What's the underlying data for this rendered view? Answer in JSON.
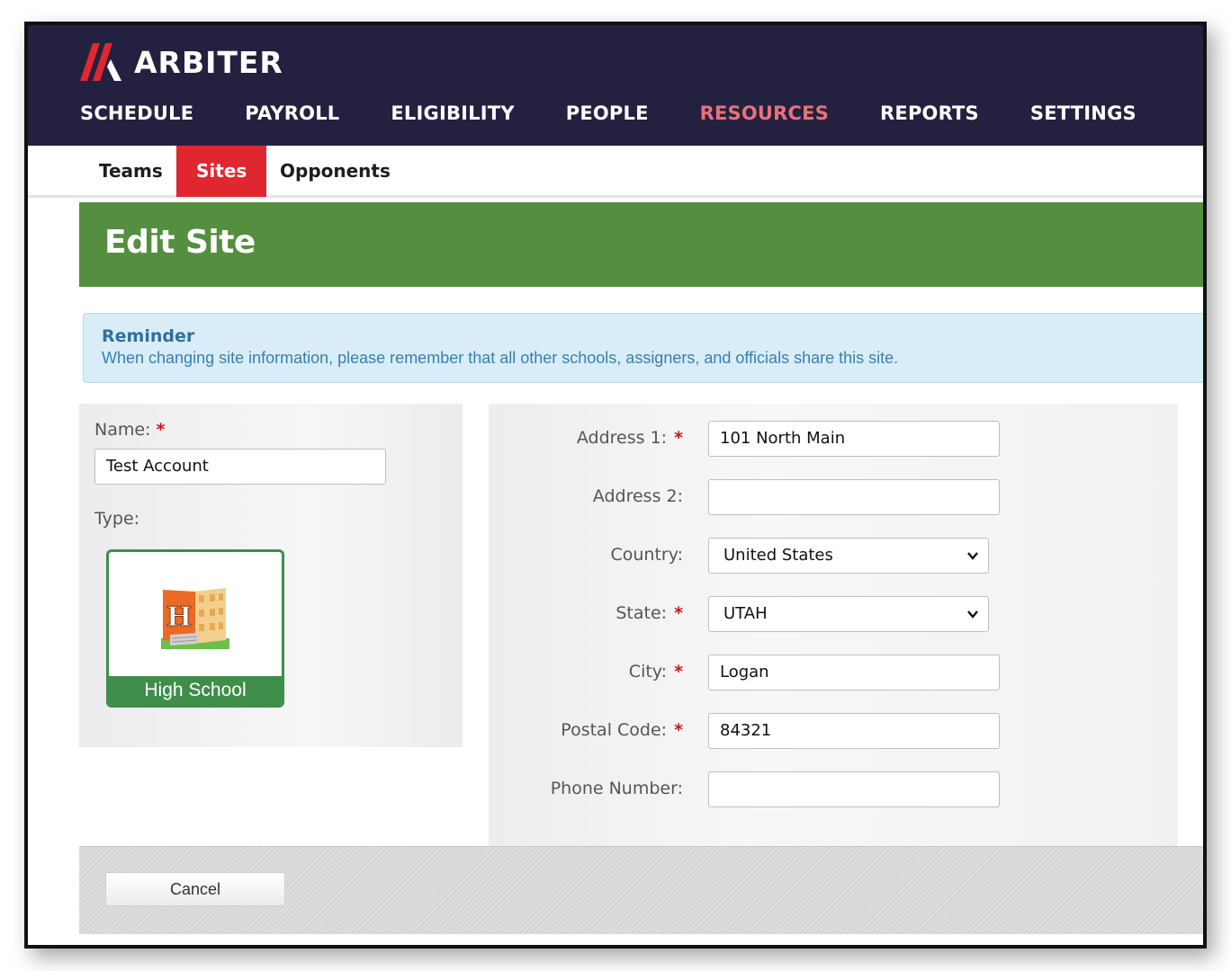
{
  "brand": {
    "name": "ARBITER",
    "logo_color": "#e0272f"
  },
  "main_nav": [
    {
      "label": "SCHEDULE",
      "active": false
    },
    {
      "label": "PAYROLL",
      "active": false
    },
    {
      "label": "ELIGIBILITY",
      "active": false
    },
    {
      "label": "PEOPLE",
      "active": false
    },
    {
      "label": "RESOURCES",
      "active": true
    },
    {
      "label": "REPORTS",
      "active": false
    },
    {
      "label": "SETTINGS",
      "active": false
    }
  ],
  "sub_nav": [
    {
      "label": "Teams",
      "active": false
    },
    {
      "label": "Sites",
      "active": true
    },
    {
      "label": "Opponents",
      "active": false
    }
  ],
  "page": {
    "title": "Edit Site"
  },
  "reminder": {
    "title": "Reminder",
    "text": "When changing site information, please remember that all other schools, assigners, and officials share this site."
  },
  "form": {
    "required_mark": "*",
    "name": {
      "label": "Name:",
      "value": "Test Account",
      "required": true
    },
    "type": {
      "label": "Type:",
      "selected": "High School",
      "icon": "school-building-icon"
    },
    "address1": {
      "label": "Address 1:",
      "value": "101 North Main",
      "required": true
    },
    "address2": {
      "label": "Address 2:",
      "value": "",
      "required": false
    },
    "country": {
      "label": "Country:",
      "value": "United States",
      "required": false
    },
    "state": {
      "label": "State:",
      "value": "UTAH",
      "required": true
    },
    "city": {
      "label": "City:",
      "value": "Logan",
      "required": true
    },
    "postal_code": {
      "label": "Postal Code:",
      "value": "84321",
      "required": true
    },
    "phone": {
      "label": "Phone Number:",
      "value": "",
      "required": false
    }
  },
  "footer": {
    "cancel_label": "Cancel"
  },
  "colors": {
    "header_bg": "#23213f",
    "active_nav": "#e8717a",
    "sites_tab": "#e0272f",
    "banner": "#548e3f",
    "reminder_bg": "#d8edf7",
    "tile_green": "#3e8e4a"
  }
}
